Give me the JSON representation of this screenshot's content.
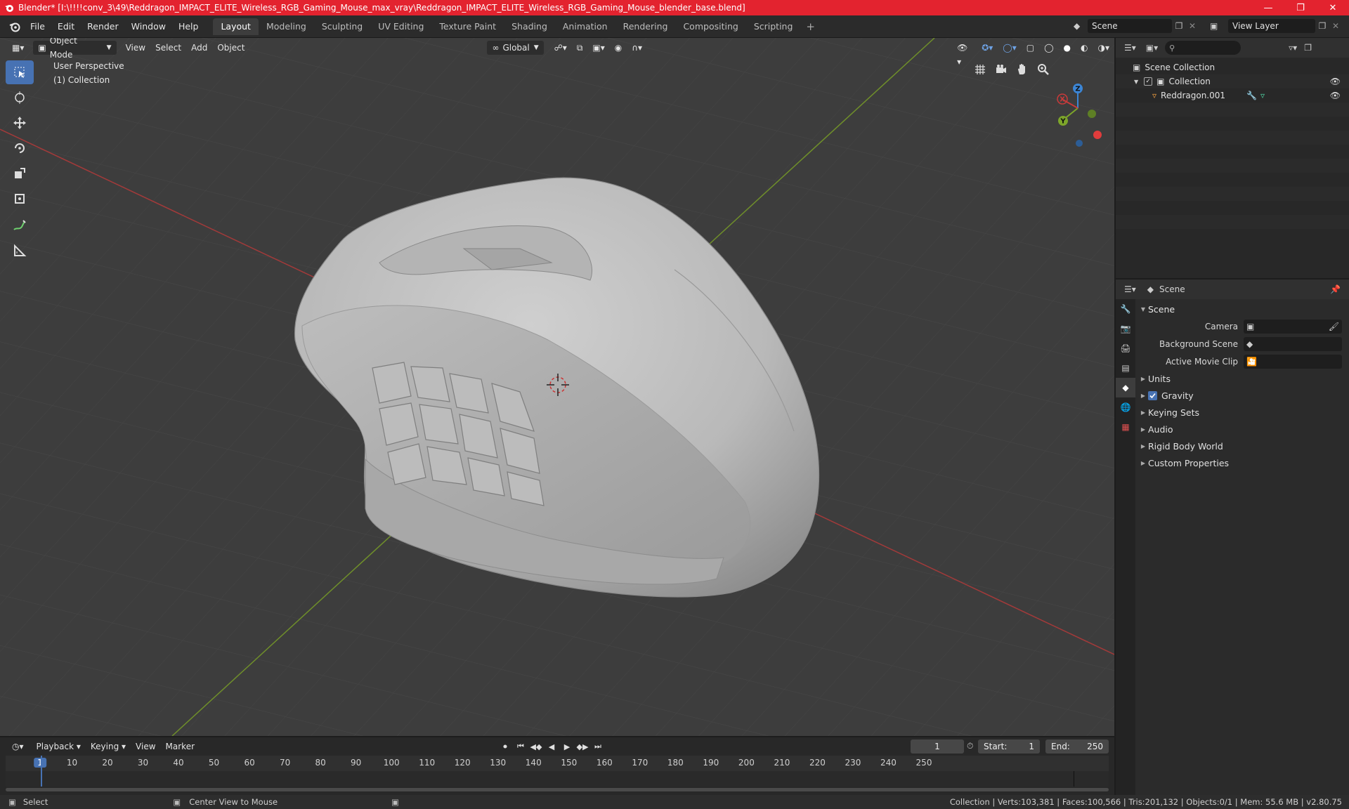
{
  "window": {
    "title": "Blender* [I:\\!!!!conv_3\\49\\Reddragon_IMPACT_ELITE_Wireless_RGB_Gaming_Mouse_max_vray\\Reddragon_IMPACT_ELITE_Wireless_RGB_Gaming_Mouse_blender_base.blend]"
  },
  "menu": {
    "file": "File",
    "edit": "Edit",
    "render": "Render",
    "window": "Window",
    "help": "Help"
  },
  "workspaces": [
    "Layout",
    "Modeling",
    "Sculpting",
    "UV Editing",
    "Texture Paint",
    "Shading",
    "Animation",
    "Rendering",
    "Compositing",
    "Scripting"
  ],
  "scene_selector": {
    "value": "Scene"
  },
  "view_layer": {
    "value": "View Layer"
  },
  "viewport": {
    "mode": "Object Mode",
    "menus": {
      "view": "View",
      "select": "Select",
      "add": "Add",
      "object": "Object"
    },
    "orientation": "Global",
    "info_perspective": "User Perspective",
    "info_collection": "(1) Collection",
    "gizmo": {
      "x": "X",
      "y": "Y",
      "z": "Z"
    }
  },
  "outliner": {
    "scene_collection": "Scene Collection",
    "collection": "Collection",
    "object": "Reddragon.001"
  },
  "properties": {
    "header_title": "Scene",
    "panel_title": "Scene",
    "camera_label": "Camera",
    "background_scene_label": "Background Scene",
    "active_movie_clip_label": "Active Movie Clip",
    "subpanels": {
      "units": "Units",
      "gravity": "Gravity",
      "keying_sets": "Keying Sets",
      "audio": "Audio",
      "rigid_body_world": "Rigid Body World",
      "custom_properties": "Custom Properties"
    },
    "gravity_enabled": true
  },
  "timeline": {
    "menus": {
      "playback": "Playback",
      "keying": "Keying",
      "view": "View",
      "marker": "Marker"
    },
    "current_frame": "1",
    "start_label": "Start:",
    "start": "1",
    "end_label": "End:",
    "end": "250",
    "ruler": [
      "1",
      "10",
      "20",
      "30",
      "40",
      "50",
      "60",
      "70",
      "80",
      "90",
      "100",
      "110",
      "120",
      "130",
      "140",
      "150",
      "160",
      "170",
      "180",
      "190",
      "200",
      "210",
      "220",
      "230",
      "240",
      "250"
    ]
  },
  "statusbar": {
    "select": "Select",
    "center_view": "Center View to Mouse",
    "stats": "Collection | Verts:103,381 | Faces:100,566 | Tris:201,132 | Objects:0/1 | Mem: 55.6 MB | v2.80.75"
  },
  "colors": {
    "titlebar": "#e3232f",
    "accent": "#4772b3",
    "viewport_bg": "#3d3d3d",
    "x_axis": "#c93a3a",
    "y_axis": "#7da52a",
    "z_axis": "#3c86d6"
  }
}
